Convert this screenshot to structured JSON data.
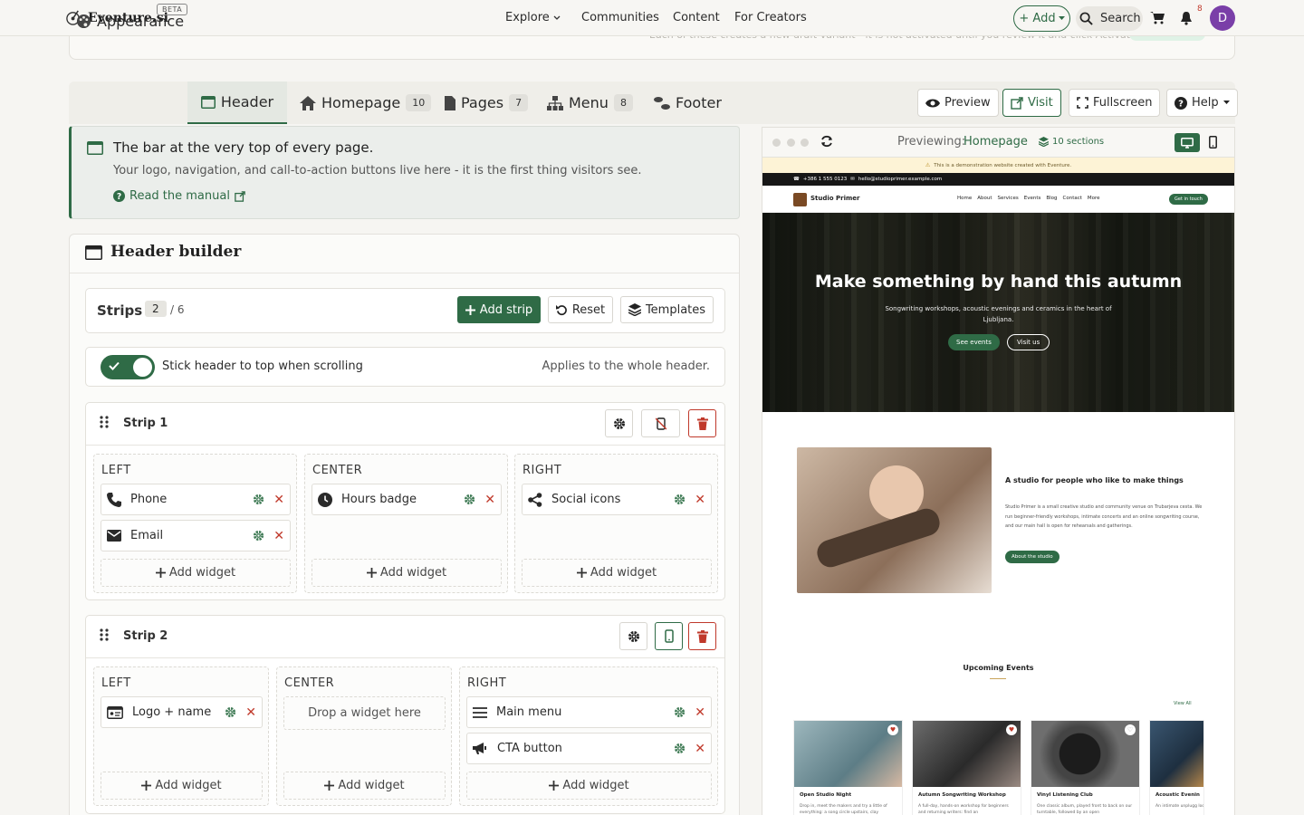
{
  "topnav": {
    "brand": "Eventure.si",
    "beta": "BETA",
    "links": [
      "Explore",
      "Communities",
      "Content",
      "For Creators"
    ],
    "add": "+ Add",
    "search": "Search",
    "notif_count": "8",
    "avatar": "D"
  },
  "ghost_banner": {
    "text": "Each of these creates a new draft variant - it is not activated until you review it and click Activate.",
    "pill": "Non-destructive"
  },
  "tabs": [
    {
      "label": "Appearance",
      "icon": "palette-icon"
    },
    {
      "label": "Header",
      "icon": "window-icon",
      "active": true
    },
    {
      "label": "Homepage",
      "count": "10",
      "icon": "home-icon"
    },
    {
      "label": "Pages",
      "count": "7",
      "icon": "file-icon"
    },
    {
      "label": "Menu",
      "count": "8",
      "icon": "sitemap-icon"
    },
    {
      "label": "Footer",
      "icon": "shoe-icon"
    }
  ],
  "tab_actions": {
    "preview": "Preview",
    "visit": "Visit",
    "fullscreen": "Fullscreen",
    "help": "Help"
  },
  "info": {
    "title": "The bar at the very top of every page.",
    "text": "Your logo, navigation, and call-to-action buttons live here - it is the first thing visitors see.",
    "link": "Read the manual"
  },
  "builder": {
    "title": "Header builder",
    "strips_label": "Strips",
    "strips_count": "2",
    "strips_max": "/ 6",
    "add_strip": "Add strip",
    "reset": "Reset",
    "templates": "Templates",
    "sticky_label": "Stick header to top when scrolling",
    "sticky_on": true,
    "sticky_note": "Applies to the whole header.",
    "add_widget": "Add widget",
    "drop_here": "Drop a widget here",
    "strips": [
      {
        "name": "Strip 1",
        "left": {
          "label": "LEFT",
          "widgets": [
            "Phone",
            "Email"
          ]
        },
        "center": {
          "label": "CENTER",
          "widgets": [
            "Hours badge"
          ]
        },
        "right": {
          "label": "RIGHT",
          "widgets": [
            "Social icons"
          ]
        }
      },
      {
        "name": "Strip 2",
        "left": {
          "label": "LEFT",
          "widgets": [
            "Logo + name"
          ]
        },
        "center": {
          "label": "CENTER",
          "widgets": []
        },
        "right": {
          "label": "RIGHT",
          "widgets": [
            "Main menu",
            "CTA button"
          ]
        }
      }
    ]
  },
  "preview": {
    "previewing": "Previewing:",
    "page": "Homepage",
    "sections": "10 sections",
    "demo_notice": "This is a demonstration website created with Eventure.",
    "phone": "+386 1 555 0123",
    "email": "hello@studioprimer.example.com",
    "site_name": "Studio Primer",
    "site_nav": [
      "Home",
      "About",
      "Services",
      "Events",
      "Blog",
      "Contact",
      "More"
    ],
    "site_cta": "Get in touch",
    "hero_title": "Make something by hand this autumn",
    "hero_text": "Songwriting workshops, acoustic evenings and ceramics in the heart of Ljubljana.",
    "hero_btn1": "See events",
    "hero_btn2": "Visit us",
    "about_title": "A studio for people who like to make things",
    "about_text": "Studio Primer is a small creative studio and community venue on Trubarjeva cesta. We run beginner-friendly workshops, intimate concerts and an online songwriting course, and our main hall is open for rehearsals and gatherings.",
    "about_btn": "About the studio",
    "events_title": "Upcoming Events",
    "view_all": "View All",
    "events": [
      {
        "title": "Open Studio Night",
        "text": "Drop in, meet the makers and try a little of everything: a song circle upstairs, clay"
      },
      {
        "title": "Autumn Songwriting Workshop",
        "text": "A full-day, hands-on workshop for beginners and returning writers: find an"
      },
      {
        "title": "Vinyl Listening Club",
        "text": "One classic album, played front to back on our turntable, followed by an open"
      },
      {
        "title": "Acoustic Evenin",
        "text": "An intimate unplugg local songwriters in c"
      }
    ]
  },
  "colors": {
    "accent": "#2f6b46",
    "danger": "#c0392b",
    "avatar": "#7a3fa8"
  }
}
